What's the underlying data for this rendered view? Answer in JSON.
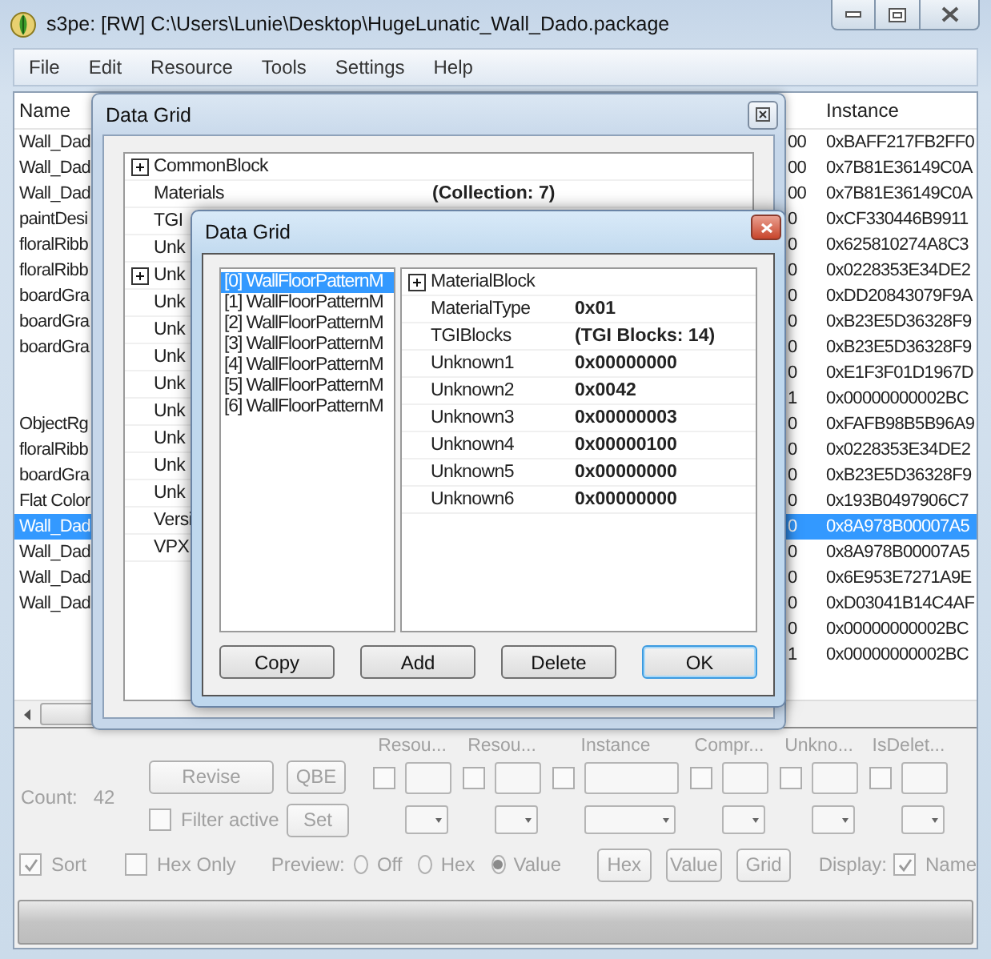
{
  "window": {
    "title": "s3pe: [RW] C:\\Users\\Lunie\\Desktop\\HugeLunatic_Wall_Dado.package"
  },
  "menu": [
    "File",
    "Edit",
    "Resource",
    "Tools",
    "Settings",
    "Help"
  ],
  "resource_list": {
    "columns": [
      "Name",
      "Instance"
    ],
    "rows": [
      {
        "name": "Wall_Dad",
        "column_2": "00",
        "instance": "0xBAFF217FB2FF0",
        "selected": false
      },
      {
        "name": "Wall_Dad",
        "column_2": "00",
        "instance": "0x7B81E36149C0A",
        "selected": false
      },
      {
        "name": "Wall_Dad",
        "column_2": "00",
        "instance": "0x7B81E36149C0A",
        "selected": false
      },
      {
        "name": "paintDesi",
        "column_2": "0",
        "instance": "0xCF330446B9911",
        "selected": false
      },
      {
        "name": "floralRibb",
        "column_2": "0",
        "instance": "0x625810274A8C3",
        "selected": false
      },
      {
        "name": "floralRibb",
        "column_2": "0",
        "instance": "0x0228353E34DE2",
        "selected": false
      },
      {
        "name": "boardGra",
        "column_2": "0",
        "instance": "0xDD20843079F9A",
        "selected": false
      },
      {
        "name": "boardGra",
        "column_2": "0",
        "instance": "0xB23E5D36328F9",
        "selected": false
      },
      {
        "name": "boardGra",
        "column_2": "0",
        "instance": "0xB23E5D36328F9",
        "selected": false
      },
      {
        "column_2": "0",
        "instance": "0xE1F3F01D1967D",
        "selected": false
      },
      {
        "column_2": "1",
        "instance": "0x00000000002BC",
        "selected": false
      },
      {
        "name": "ObjectRg",
        "column_2": "0",
        "instance": "0xFAFB98B5B96A9",
        "selected": false
      },
      {
        "name": "floralRibb",
        "column_2": "0",
        "instance": "0x0228353E34DE2",
        "selected": false
      },
      {
        "name": "boardGra",
        "column_2": "0",
        "instance": "0xB23E5D36328F9",
        "selected": false
      },
      {
        "name": "Flat Color",
        "column_2": "0",
        "instance": "0x193B0497906C7",
        "selected": false
      },
      {
        "name": "Wall_Dad",
        "column_2": "0",
        "instance": "0x8A978B00007A5",
        "selected": true
      },
      {
        "name": "Wall_Dad",
        "column_2": "0",
        "instance": "0x8A978B00007A5",
        "selected": false
      },
      {
        "name": "Wall_Dad",
        "column_2": "0",
        "instance": "0x6E953E7271A9E",
        "selected": false
      },
      {
        "name": "Wall_Dad",
        "column_2": "0",
        "instance": "0xD03041B14C4AF",
        "selected": false
      },
      {
        "column_2": "0",
        "instance": "0x00000000002BC",
        "selected": false
      },
      {
        "column_2": "1",
        "instance": "0x00000000002BC",
        "selected": false
      }
    ]
  },
  "outer_dialog": {
    "title": "Data Grid",
    "properties": [
      {
        "name": "CommonBlock",
        "expandable": true
      },
      {
        "name": "Materials",
        "value": "(Collection: 7)",
        "expandable": false
      },
      {
        "name": "TGI",
        "expandable": false
      },
      {
        "name": "Unk",
        "expandable": false
      },
      {
        "name": "Unk",
        "expandable": true
      },
      {
        "name": "Unk",
        "expandable": false
      },
      {
        "name": "Unk",
        "expandable": false
      },
      {
        "name": "Unk",
        "expandable": false
      },
      {
        "name": "Unk",
        "expandable": false
      },
      {
        "name": "Unk",
        "expandable": false
      },
      {
        "name": "Unk",
        "expandable": false
      },
      {
        "name": "Unk",
        "expandable": false
      },
      {
        "name": "Unk",
        "expandable": false
      },
      {
        "name": "Versi",
        "expandable": false
      },
      {
        "name": "VPX",
        "expandable": false
      }
    ]
  },
  "inner_dialog": {
    "title": "Data Grid",
    "items": [
      {
        "label": "[0] WallFloorPatternM",
        "selected": true
      },
      {
        "label": "[1] WallFloorPatternM",
        "selected": false
      },
      {
        "label": "[2] WallFloorPatternM",
        "selected": false
      },
      {
        "label": "[3] WallFloorPatternM",
        "selected": false
      },
      {
        "label": "[4] WallFloorPatternM",
        "selected": false
      },
      {
        "label": "[5] WallFloorPatternM",
        "selected": false
      },
      {
        "label": "[6] WallFloorPatternM",
        "selected": false
      }
    ],
    "properties": [
      {
        "name": "MaterialBlock",
        "expandable": true
      },
      {
        "name": "MaterialType",
        "value": "0x01",
        "expandable": false
      },
      {
        "name": "TGIBlocks",
        "value": "(TGI Blocks: 14)",
        "expandable": false
      },
      {
        "name": "Unknown1",
        "value": "0x00000000",
        "expandable": false
      },
      {
        "name": "Unknown2",
        "value": "0x0042",
        "expandable": false
      },
      {
        "name": "Unknown3",
        "value": "0x00000003",
        "expandable": false
      },
      {
        "name": "Unknown4",
        "value": "0x00000100",
        "expandable": false
      },
      {
        "name": "Unknown5",
        "value": "0x00000000",
        "expandable": false
      },
      {
        "name": "Unknown6",
        "value": "0x00000000",
        "expandable": false
      }
    ],
    "buttons": [
      {
        "label": "Copy",
        "default": false
      },
      {
        "label": "Add",
        "default": false
      },
      {
        "label": "Delete",
        "default": false
      },
      {
        "label": "OK",
        "default": true
      }
    ]
  },
  "filter_panel": {
    "disabled": true,
    "count_label": "Count:",
    "count": "42",
    "revise": "Revise",
    "qbe": "QBE",
    "set": "Set",
    "filter_active": {
      "label": "Filter active",
      "checked": false
    },
    "columns": [
      {
        "label": "Resou...",
        "checked": false,
        "kind": "small"
      },
      {
        "label": "Resou...",
        "checked": false,
        "kind": "small"
      },
      {
        "label": "Instance",
        "checked": false,
        "kind": "wide"
      },
      {
        "label": "Compr...",
        "checked": false,
        "kind": "small"
      },
      {
        "label": "Unkno...",
        "checked": false,
        "kind": "small"
      },
      {
        "label": "IsDelet...",
        "checked": false,
        "kind": "small"
      }
    ],
    "sort": {
      "label": "Sort",
      "checked": true
    },
    "hex_only": {
      "label": "Hex Only",
      "checked": false
    },
    "preview_label": "Preview:",
    "preview_options": [
      {
        "label": "Off",
        "selected": false
      },
      {
        "label": "Hex",
        "selected": false
      },
      {
        "label": "Value",
        "selected": true
      }
    ],
    "view_buttons": [
      "Hex",
      "Value",
      "Grid"
    ],
    "display_label": "Display:",
    "names": {
      "label": "Name",
      "checked": true
    }
  }
}
